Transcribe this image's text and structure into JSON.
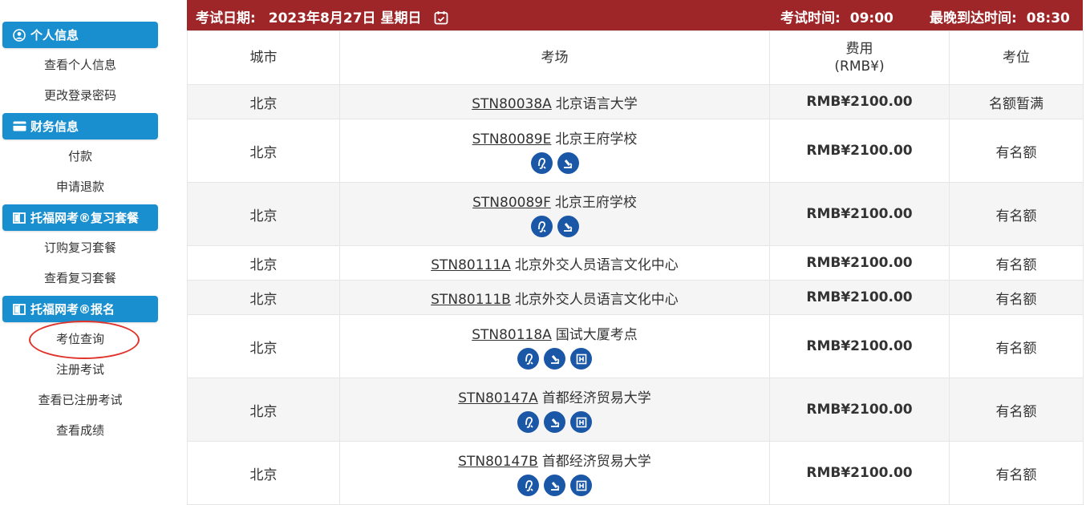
{
  "sidebar": {
    "sections": [
      {
        "title": "个人信息",
        "icon": "user-circle-icon",
        "links": [
          "查看个人信息",
          "更改登录密码"
        ]
      },
      {
        "title": "财务信息",
        "icon": "credit-card-icon",
        "links": [
          "付款",
          "申请退款"
        ]
      },
      {
        "title": "托福网考®复习套餐",
        "icon": "book-icon",
        "links": [
          "订购复习套餐",
          "查看复习套餐"
        ]
      },
      {
        "title": "托福网考®报名",
        "icon": "book-icon",
        "links": [
          "考位查询",
          "注册考试",
          "查看已注册考试",
          "查看成绩"
        ]
      }
    ],
    "highlighted_link": "考位查询",
    "highlight_color": "#e0342b"
  },
  "topbar": {
    "date_label": "考试日期:",
    "date_value": "2023年8月27日 星期日",
    "calendar_icon": "calendar-icon",
    "exam_time_label": "考试时间:",
    "exam_time_value": "09:00",
    "arrive_label": "最晚到达时间:",
    "arrive_value": "08:30",
    "color": "#9e2628"
  },
  "table": {
    "headers": {
      "city": "城市",
      "venue": "考场",
      "fee_line1": "费用",
      "fee_line2": "(RMB¥)",
      "seat": "考位"
    },
    "rows": [
      {
        "city": "北京",
        "code": "STN80038A",
        "name": "北京语言大学",
        "fee": "RMB¥2100.00",
        "seat": "名额暂满",
        "icons": []
      },
      {
        "city": "北京",
        "code": "STN80089E",
        "name": "北京王府学校",
        "fee": "RMB¥2100.00",
        "seat": "有名额",
        "icons": [
          "ear-icon",
          "microscope-icon"
        ]
      },
      {
        "city": "北京",
        "code": "STN80089F",
        "name": "北京王府学校",
        "fee": "RMB¥2100.00",
        "seat": "有名额",
        "icons": [
          "ear-icon",
          "microscope-icon"
        ]
      },
      {
        "city": "北京",
        "code": "STN80111A",
        "name": "北京外交人员语言文化中心",
        "fee": "RMB¥2100.00",
        "seat": "有名额",
        "icons": []
      },
      {
        "city": "北京",
        "code": "STN80111B",
        "name": "北京外交人员语言文化中心",
        "fee": "RMB¥2100.00",
        "seat": "有名额",
        "icons": []
      },
      {
        "city": "北京",
        "code": "STN80118A",
        "name": "国试大厦考点",
        "fee": "RMB¥2100.00",
        "seat": "有名额",
        "icons": [
          "ear-icon",
          "microscope-icon",
          "hospital-icon"
        ]
      },
      {
        "city": "北京",
        "code": "STN80147A",
        "name": "首都经济贸易大学",
        "fee": "RMB¥2100.00",
        "seat": "有名额",
        "icons": [
          "ear-icon",
          "microscope-icon",
          "hospital-icon"
        ]
      },
      {
        "city": "北京",
        "code": "STN80147B",
        "name": "首都经济贸易大学",
        "fee": "RMB¥2100.00",
        "seat": "有名额",
        "icons": [
          "ear-icon",
          "microscope-icon",
          "hospital-icon"
        ]
      }
    ]
  },
  "colors": {
    "sidebar_header": "#1a8fcf",
    "icon_badge": "#1b57a7",
    "stripe": "#f5f5f5"
  }
}
